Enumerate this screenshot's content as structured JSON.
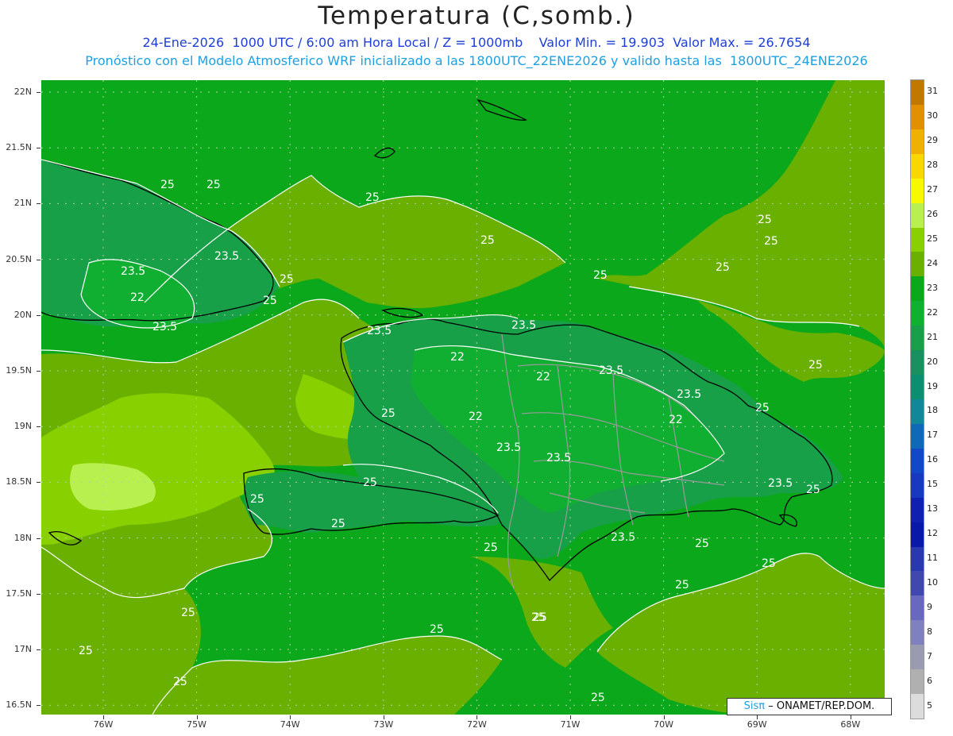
{
  "header": {
    "title": "Temperatura (C,somb.)",
    "subtitle_line1": "24-Ene-2026  1000 UTC / 6:00 am Hora Local / Z = 1000mb    Valor Min. = 19.903  Valor Max. = 26.7654",
    "subtitle_line2": "Pronóstico con el Modelo Atmosferico WRF inicializado a las 1800UTC_22ENE2026 y valido hasta las  1800UTC_24ENE2026"
  },
  "axes": {
    "lat_labels": [
      "22N",
      "21.5N",
      "21N",
      "20.5N",
      "20N",
      "19.5N",
      "19N",
      "18.5N",
      "18N",
      "17.5N",
      "17N",
      "16.5N"
    ],
    "lon_labels": [
      "76W",
      "75W",
      "74W",
      "73W",
      "72W",
      "71W",
      "70W",
      "69W",
      "68W"
    ]
  },
  "colorbar": {
    "labels": [
      "31",
      "30",
      "29",
      "28",
      "27",
      "26",
      "25",
      "24",
      "23",
      "22",
      "21",
      "20",
      "19",
      "18",
      "17",
      "16",
      "15",
      "13",
      "12",
      "11",
      "10",
      "9",
      "8",
      "7",
      "6",
      "5"
    ],
    "colors": [
      "#c07800",
      "#e09000",
      "#f0b000",
      "#f8d800",
      "#f8f800",
      "#b8f050",
      "#88d000",
      "#6ab000",
      "#0aa81a",
      "#10b030",
      "#18a048",
      "#189060",
      "#0a9070",
      "#108898",
      "#1068b8",
      "#1048c8",
      "#1838c0",
      "#1020b0",
      "#0818a8",
      "#2838b0",
      "#4048b0",
      "#6868c0",
      "#8080c0",
      "#9a9ab0",
      "#b0b0b0",
      "#dcdcdc"
    ]
  },
  "contour_labels": [
    "25",
    "23.5",
    "22"
  ],
  "credit": {
    "brand": "Sisπ",
    "org": "– ONAMET/REP.DOM."
  }
}
